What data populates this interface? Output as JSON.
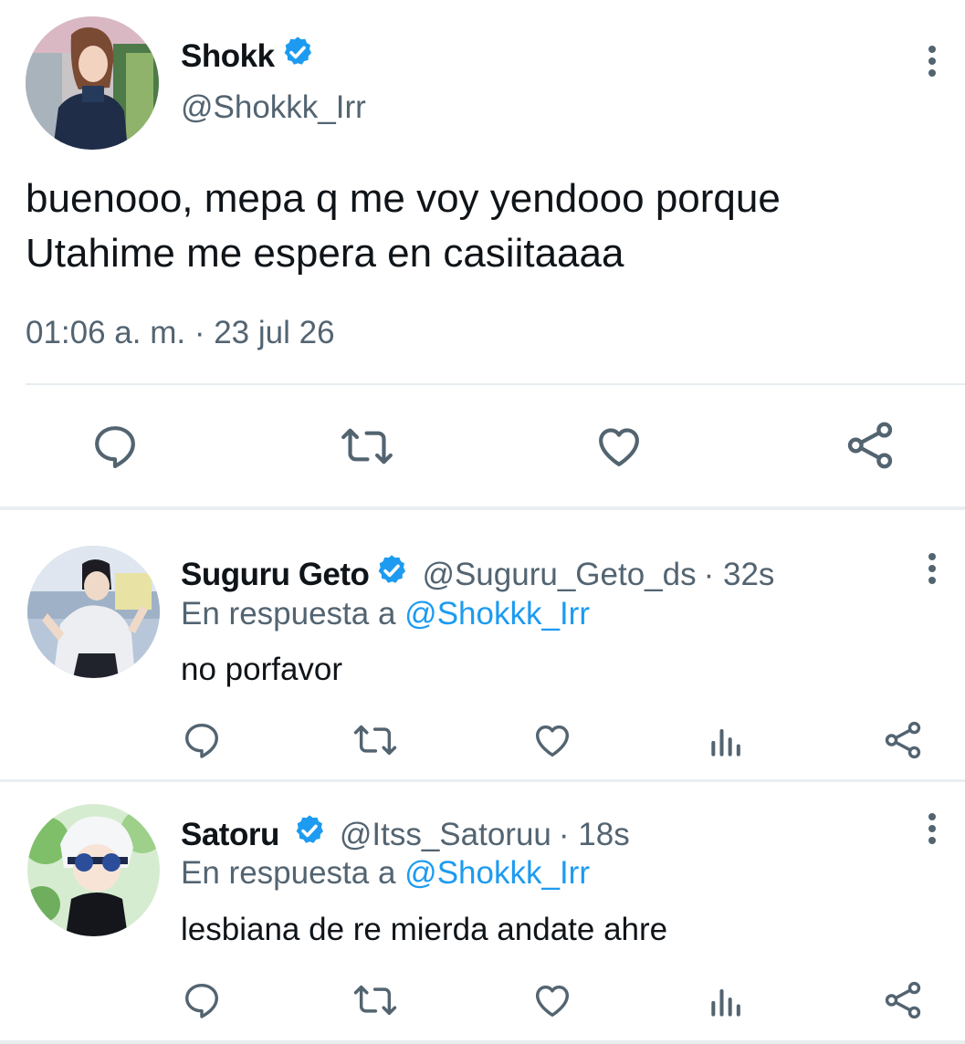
{
  "main_tweet": {
    "author_name": "Shokk",
    "author_handle": "@Shokkk_Irr",
    "text_line1": "buenooo, mepa q me voy yendooo porque",
    "text_line2": "Utahime me espera en casiitaaaa",
    "timestamp": "01:06 a. m. · 23 jul 26",
    "verified": true
  },
  "replies": [
    {
      "author_name": "Suguru Geto",
      "author_handle": "@Suguru_Geto_ds",
      "time_ago": "· 32s",
      "reply_prefix": "En respuesta a",
      "reply_mention": "@Shokkk_Irr",
      "text": "no porfavor",
      "verified": true
    },
    {
      "author_name": "Satoru",
      "author_handle": "@Itss_Satoruu",
      "time_ago": "· 18s",
      "reply_prefix": "En respuesta a",
      "reply_mention": "@Shokkk_Irr",
      "text": "lesbiana de re mierda andate ahre",
      "verified": true
    }
  ],
  "colors": {
    "verified_blue": "#1d9bf0",
    "secondary_text": "#536471",
    "mention": "#1d9bf0",
    "divider": "#e6ecf0"
  },
  "icons": {
    "reply": "speech-bubble-icon",
    "retweet": "retweet-icon",
    "like": "heart-icon",
    "analytics": "bar-chart-icon",
    "share": "share-icon",
    "menu": "vertical-dots-icon"
  }
}
